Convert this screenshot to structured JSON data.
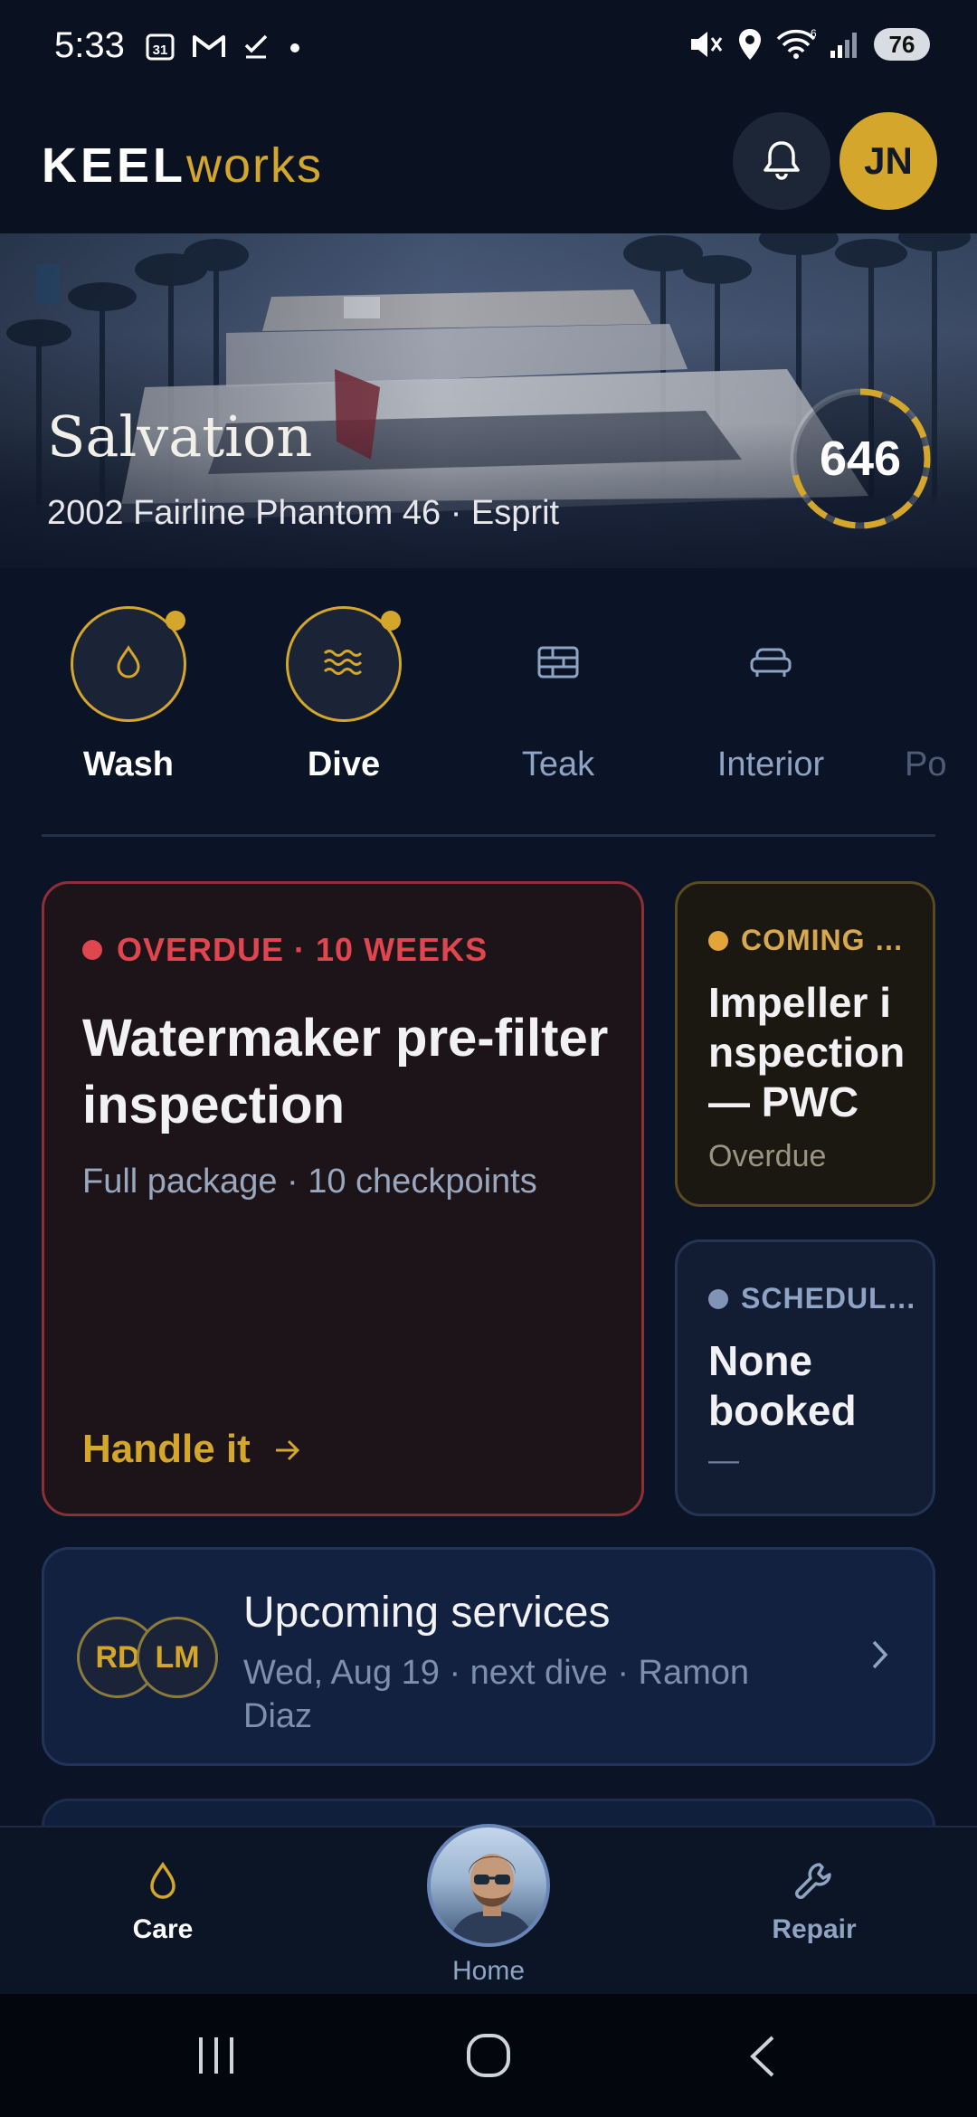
{
  "status_bar": {
    "time": "5:33",
    "battery": "76",
    "icons": [
      "calendar-icon",
      "gmail-icon",
      "task-check-icon",
      "dot-icon",
      "mute-icon",
      "location-icon",
      "wifi-icon",
      "signal-icon"
    ]
  },
  "header": {
    "logo_primary": "KEEL",
    "logo_secondary": "works",
    "avatar_initials": "JN"
  },
  "hero": {
    "boat_name": "Salvation",
    "boat_details": "2002 Fairline Phantom 46 · Esprit",
    "score": "646",
    "score_fraction": 0.78
  },
  "categories": [
    {
      "label": "Wash",
      "icon": "droplet-icon",
      "active": true
    },
    {
      "label": "Dive",
      "icon": "waves-icon",
      "active": true
    },
    {
      "label": "Teak",
      "icon": "deck-planks-icon",
      "active": false
    },
    {
      "label": "Interior",
      "icon": "sofa-icon",
      "active": false
    },
    {
      "label": "Po",
      "icon": "",
      "active": false
    }
  ],
  "overdue_card": {
    "tag": "OVERDUE · 10 WEEKS",
    "title": "Watermaker pre-filter inspection",
    "subtitle": "Full package · 10 checkpoints",
    "cta": "Handle it"
  },
  "coming_card": {
    "tag": "COMING …",
    "title": "Impeller inspection — PWC",
    "subtitle": "Overdue"
  },
  "scheduled_card": {
    "tag": "SCHEDUL…",
    "title": "None booked",
    "subtitle": "—"
  },
  "upcoming": {
    "avatars": [
      "RD",
      "LM"
    ],
    "title": "Upcoming services",
    "subtitle": "Wed, Aug 19 · next dive · Ramon Diaz"
  },
  "bottom_nav": {
    "care": "Care",
    "home": "Home",
    "repair": "Repair"
  },
  "colors": {
    "accent_gold": "#d4a72c",
    "overdue_red": "#e0464f",
    "coming_amber": "#e3a43a",
    "background": "#0b1426"
  }
}
